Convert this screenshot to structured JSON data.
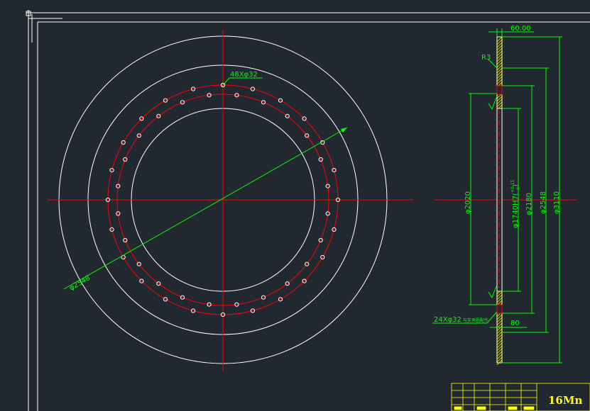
{
  "colors": {
    "background": "#212830",
    "outline": "#ffffff",
    "centerline": "#ff0000",
    "dimension": "#00ff00",
    "hatch": "#ffff00",
    "title_block": "#ffff00"
  },
  "front_view": {
    "hole_callout": "48Xφ32",
    "diameter_label": "φ2548"
  },
  "section_view": {
    "thickness_label": "60.00",
    "radius_label": "R3",
    "bore_2020_label": "φ2020",
    "bore_1740_label": "φ1740H7(",
    "bore_1740_tol_upper": "+0.15",
    "bore_1740_tol_lower": "0",
    "bore_1740_close": ")",
    "dia_2180_label": "φ2180",
    "dia_2548_label": "φ2548",
    "dia_3110_label": "φ3110",
    "hole_callout": "24Xφ32",
    "hole_note": "与支承圈配作",
    "step_label": "80"
  },
  "title_block": {
    "material": "16Mn"
  }
}
